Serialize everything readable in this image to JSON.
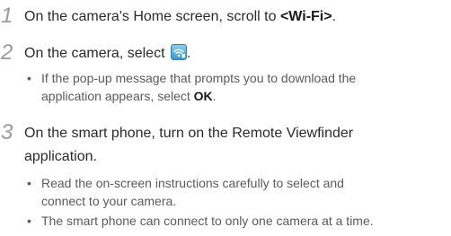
{
  "steps": [
    {
      "number": "1",
      "text_before": "On the camera's Home screen, scroll to ",
      "text_bold": "<Wi-Fi>",
      "text_after": "."
    },
    {
      "number": "2",
      "text_before": "On the camera, select ",
      "icon": "remote-viewfinder-wifi-icon",
      "text_after": ".",
      "bullets": [
        {
          "line1": "If the pop-up message that prompts you to download the",
          "line2_before": "application appears, select ",
          "line2_bold": "OK",
          "line2_after": "."
        }
      ]
    },
    {
      "number": "3",
      "line1": "On the smart phone, turn on the Remote Viewfinder",
      "line2": "application.",
      "bullets": [
        {
          "line1": "Read the on-screen instructions carefully to select and",
          "line2": "connect to your camera."
        },
        {
          "line1": "The smart phone can connect to only one camera at a time."
        }
      ]
    }
  ],
  "colors": {
    "step_number": "#9a9a9a",
    "icon_bg": "#5fb3d9"
  }
}
